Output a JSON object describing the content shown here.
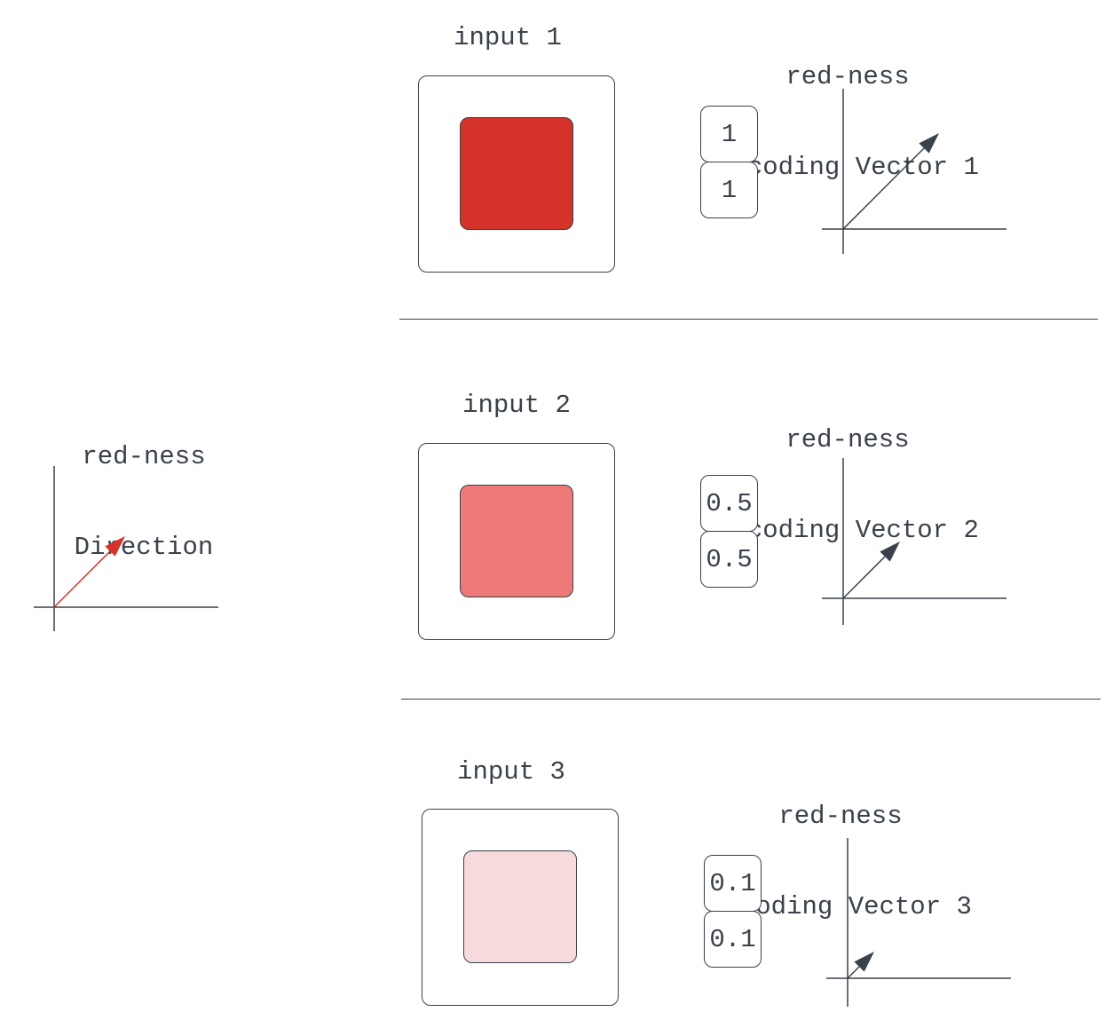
{
  "direction": {
    "title_line1": "red-ness",
    "title_line2": "Direction",
    "vector": [
      1,
      1
    ],
    "arrow_color": "#d5322a"
  },
  "rows": [
    {
      "input_label": "input 1",
      "encoding_title_line1": "red-ness",
      "encoding_title_line2": "encoding Vector 1",
      "swatch_color": "#d5322a",
      "values": [
        "1",
        "1"
      ],
      "vector": [
        1,
        1
      ]
    },
    {
      "input_label": "input 2",
      "encoding_title_line1": "red-ness",
      "encoding_title_line2": "encoding Vector 2",
      "swatch_color": "#ee7a77",
      "values": [
        "0.5",
        "0.5"
      ],
      "vector": [
        0.5,
        0.5
      ]
    },
    {
      "input_label": "input 3",
      "encoding_title_line1": "red-ness",
      "encoding_title_line2": "encoding Vector 3",
      "swatch_color": "#f7dadc",
      "values": [
        "0.1",
        "0.1"
      ],
      "vector": [
        0.1,
        0.1
      ]
    }
  ],
  "colors": {
    "ink": "#3a414a",
    "red": "#d5322a"
  }
}
